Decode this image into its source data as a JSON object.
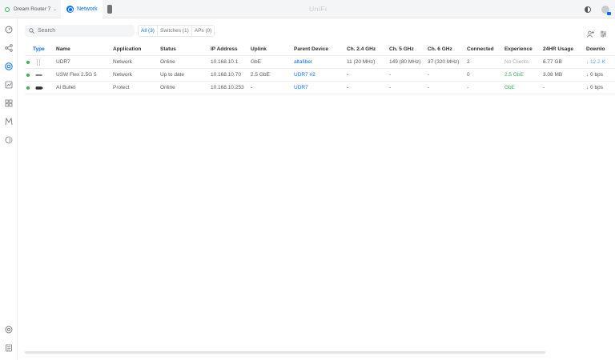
{
  "topbar": {
    "site_name": "Dream Router 7",
    "app_tab_label": "Network",
    "brand": "UniFi"
  },
  "toolbar": {
    "search_placeholder": "Search",
    "filters": [
      {
        "label": "All (3)",
        "active": true
      },
      {
        "label": "Switches (1)",
        "active": false
      },
      {
        "label": "APs (0)",
        "active": false
      }
    ]
  },
  "table": {
    "columns": [
      "Type",
      "Name",
      "Application",
      "Status",
      "IP Address",
      "Uplink",
      "Parent Device",
      "Ch. 2.4 GHz",
      "Ch. 5 GHz",
      "Ch. 6 GHz",
      "Connected",
      "Experience",
      "24HR Usage",
      "Downlo"
    ],
    "rows": [
      {
        "name": "UDR7",
        "application": "Network",
        "status": "Online",
        "ip": "10.168.10.1",
        "uplink": "GbE",
        "parent": "altafiber",
        "ch24": "11 (20 MHz)",
        "ch5": "149 (80 MHz)",
        "ch6": "37 (320 MHz)",
        "connected": "2",
        "experience": "No Clients",
        "usage": "6.77 GB",
        "download": "↓ 12.2 K"
      },
      {
        "name": "USW Flex 2.5G 5",
        "application": "Network",
        "status": "Up to date",
        "ip": "10.168.10.70",
        "uplink": "2.5 GbE",
        "parent": "UDR7 #2",
        "ch24": "-",
        "ch5": "-",
        "ch6": "-",
        "connected": "0",
        "experience": "2.5 GbE",
        "usage": "3.08 MB",
        "download": "↓ 0 bps"
      },
      {
        "name": "AI Bullet",
        "application": "Protect",
        "status": "Online",
        "ip": "10.168.10.253",
        "uplink": "-",
        "parent": "UDR7",
        "ch24": "-",
        "ch5": "-",
        "ch6": "-",
        "connected": "-",
        "experience": "GbE",
        "usage": "-",
        "download": "↓ 0 bps"
      }
    ]
  },
  "colors": {
    "accent": "#006fff",
    "online": "#38b35b",
    "muted": "#a6abb1"
  }
}
